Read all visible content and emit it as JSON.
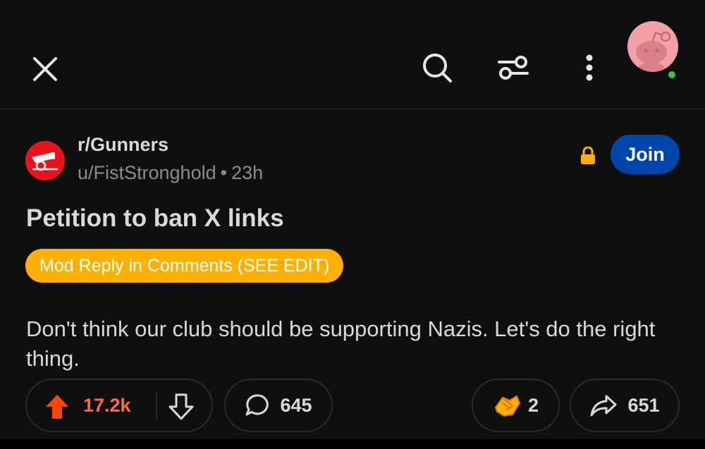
{
  "header": {
    "close_icon": "close-icon",
    "search_icon": "search-icon",
    "filter_icon": "filter-sliders-icon",
    "more_icon": "more-vertical-icon",
    "avatar_icon": "reddit-snoo-avatar",
    "online_color": "#2ecc40"
  },
  "post": {
    "subreddit": "r/Gunners",
    "author": "u/FistStronghold",
    "separator": "•",
    "age": "23h",
    "lock_icon": "lock-icon",
    "join_label": "Join",
    "title": "Petition to ban X links",
    "flair": "Mod Reply in Comments (SEE EDIT)",
    "body": "Don't think our club should be supporting Nazis. Let's do the right thing.",
    "colors": {
      "join_bg": "#0045ac",
      "flair_bg": "#ffb000",
      "upvote_active": "#ff4500",
      "subreddit_icon_bg": "#e8141a"
    }
  },
  "actions": {
    "votes": "17.2k",
    "comments": "645",
    "awards": "2",
    "shares": "651"
  }
}
